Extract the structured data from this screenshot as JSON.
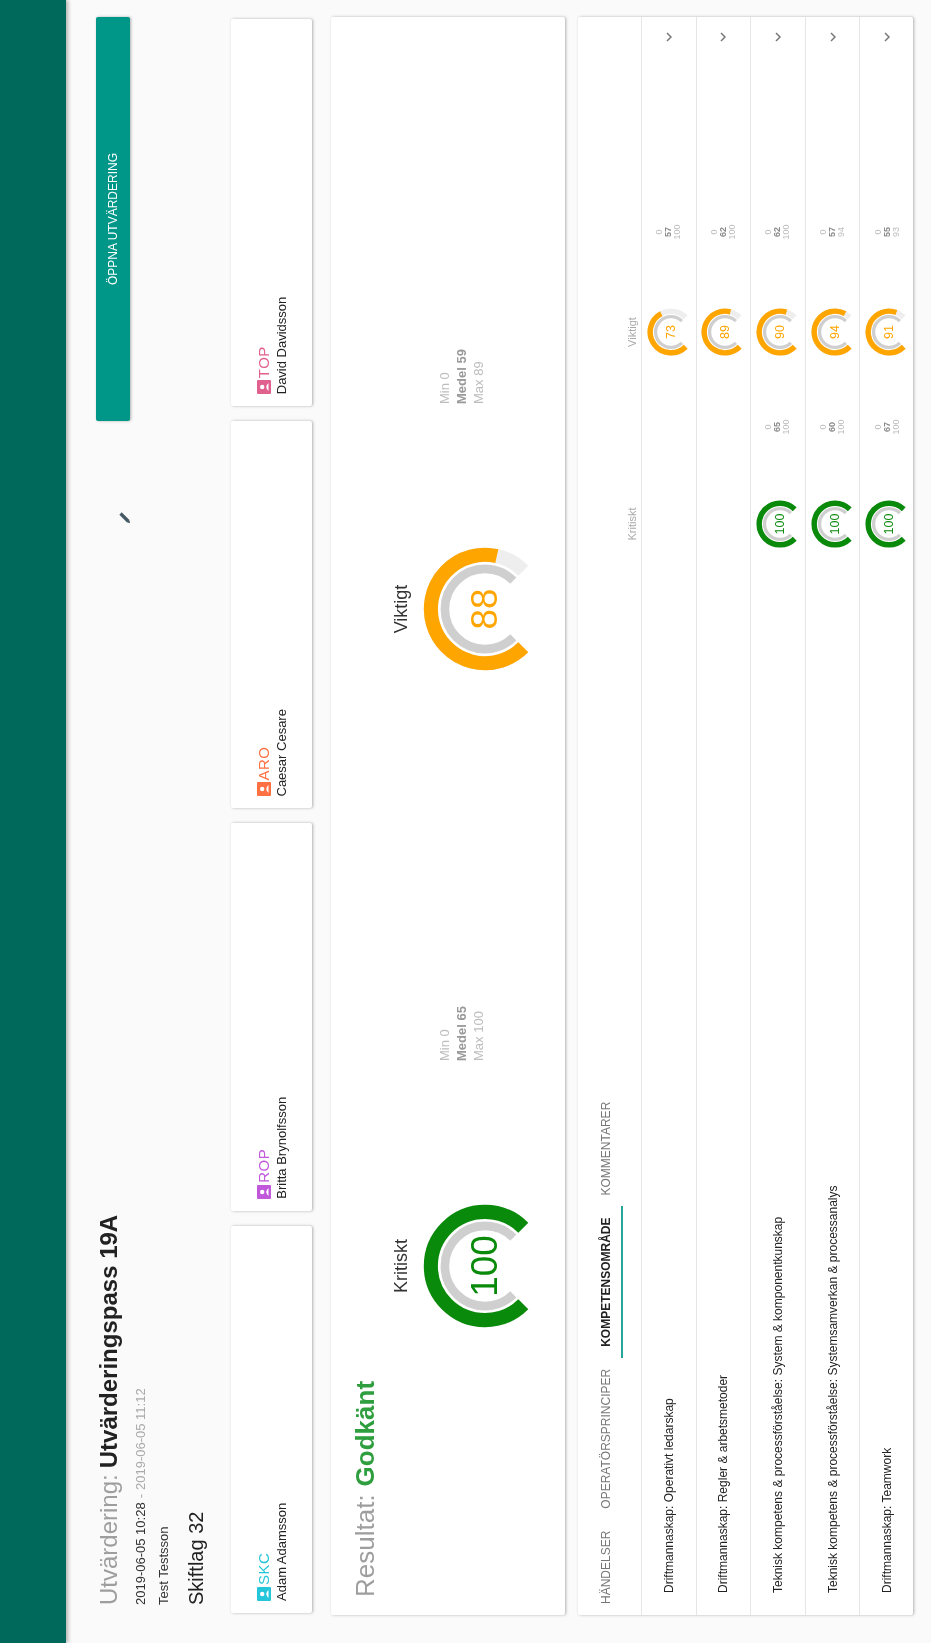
{
  "header": {
    "title_label": "Utvärdering:",
    "title": "Utvärderingspass 19A",
    "start": "2019-06-05 10:28",
    "separator": "-",
    "end": "2019-06-05 11:12",
    "author": "Test Testsson",
    "team": "Skiftlag 32"
  },
  "open_button": "ÖPPNA UTVÄRDERING",
  "roles": [
    {
      "role": "SKC",
      "name": "Adam Adamsson",
      "color": "#26c6da"
    },
    {
      "role": "ROP",
      "name": "Britta Brynolfsson",
      "color": "#c158dc"
    },
    {
      "role": "ARO",
      "name": "Caesar Cesare",
      "color": "#ff7043"
    },
    {
      "role": "TOP",
      "name": "David Davidsson",
      "color": "#e0608e"
    }
  ],
  "result": {
    "label": "Resultat:",
    "value": "Godkänt",
    "gauges": [
      {
        "kind": "critical",
        "title": "Kritiskt",
        "value": "100",
        "stats": [
          "Min 0",
          "Medel 65",
          "Max 100"
        ]
      },
      {
        "kind": "important",
        "title": "Viktigt",
        "value": "88",
        "stats": [
          "Min 0",
          "Medel 59",
          "Max 89"
        ]
      }
    ]
  },
  "tabs": [
    {
      "label": "HÄNDELSER",
      "selected": false
    },
    {
      "label": "OPERATÖRSPRINCIPER",
      "selected": false
    },
    {
      "label": "KOMPETENSOMRÅDE",
      "selected": true
    },
    {
      "label": "KOMMENTARER",
      "selected": false
    }
  ],
  "columns": [
    "Kritiskt",
    "Viktigt"
  ],
  "rows": [
    {
      "label": "Driftmannaskap: Operativt ledarskap",
      "important": {
        "value": "73",
        "min": "0",
        "mean": "57",
        "max": "100"
      }
    },
    {
      "label": "Driftmannaskap: Regler & arbetsmetoder",
      "important": {
        "value": "89",
        "min": "0",
        "mean": "62",
        "max": "100"
      }
    },
    {
      "label": "Teknisk kompetens & processförståelse: System & komponentkunskap",
      "critical": {
        "value": "100",
        "min": "0",
        "mean": "65",
        "max": "100"
      },
      "important": {
        "value": "90",
        "min": "0",
        "mean": "62",
        "max": "100"
      }
    },
    {
      "label": "Teknisk kompetens & processförståelse: Systemsamverkan & processanalys",
      "critical": {
        "value": "100",
        "min": "0",
        "mean": "60",
        "max": "100"
      },
      "important": {
        "value": "94",
        "min": "0",
        "mean": "57",
        "max": "94"
      }
    },
    {
      "label": "Driftmannaskap: Teamwork",
      "critical": {
        "value": "100",
        "min": "0",
        "mean": "67",
        "max": "100"
      },
      "important": {
        "value": "91",
        "min": "0",
        "mean": "55",
        "max": "93"
      }
    }
  ]
}
